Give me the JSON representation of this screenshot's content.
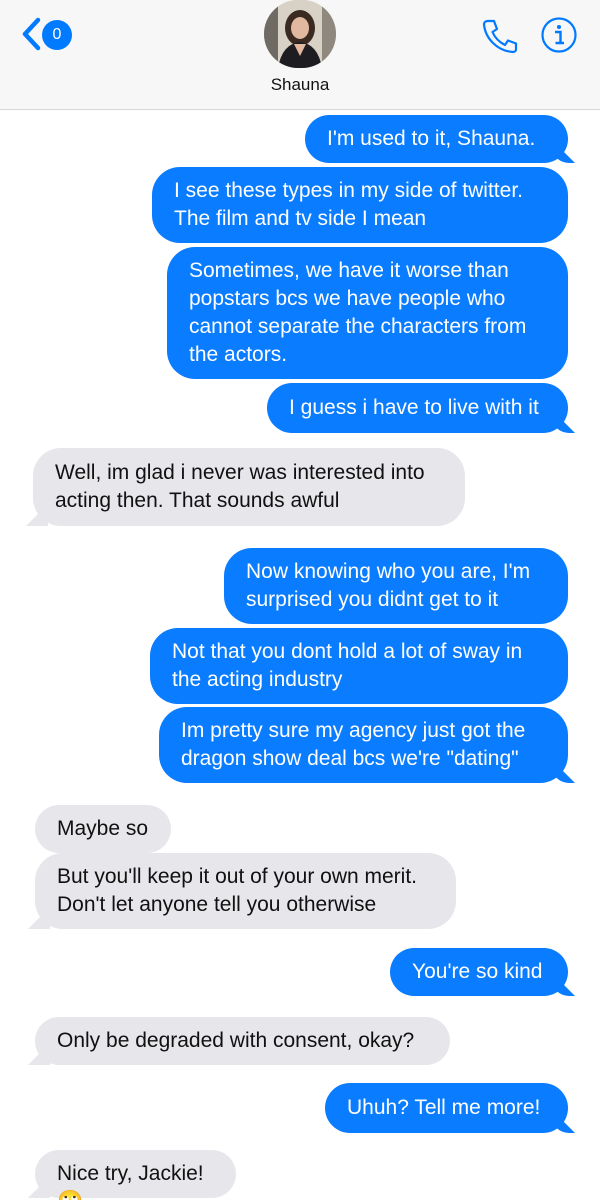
{
  "header": {
    "back_badge": "0",
    "contact_name": "Shauna",
    "icons": [
      "chevron-left-icon",
      "phone-icon",
      "info-icon"
    ],
    "accent_color": "#007aff"
  },
  "colors": {
    "outgoing": "#0a7cff",
    "incoming": "#e6e6eb"
  },
  "messages": [
    {
      "from": "me",
      "text": "I'm used to it, Shauna."
    },
    {
      "from": "me",
      "text": "I see these types in my side of twitter.\nThe film and tv side I mean"
    },
    {
      "from": "me",
      "text": "Sometimes, we have it worse than\npopstars bcs we have people who\ncannot separate the characters from\nthe actors."
    },
    {
      "from": "me",
      "text": "I guess i have to live with it"
    },
    {
      "from": "them",
      "text": "Well, im glad i never was interested into\nacting then. That sounds awful"
    },
    {
      "from": "me",
      "text": "Now knowing who you are, I'm\nsurprised you didnt get to it"
    },
    {
      "from": "me",
      "text": "Not that you dont hold a lot of sway in\nthe acting industry"
    },
    {
      "from": "me",
      "text": "Im pretty sure my agency just got the\ndragon show deal bcs we're \"dating\""
    },
    {
      "from": "them",
      "text": "Maybe so"
    },
    {
      "from": "them",
      "text": "But you'll keep it out of your own merit.\nDon't let anyone tell you otherwise"
    },
    {
      "from": "me",
      "text": "You're so kind"
    },
    {
      "from": "them",
      "text": "Only be degraded with consent, okay?"
    },
    {
      "from": "me",
      "text": "Uhuh? Tell me more!"
    },
    {
      "from": "them",
      "text": "Nice try, Jackie! 🙄"
    }
  ]
}
